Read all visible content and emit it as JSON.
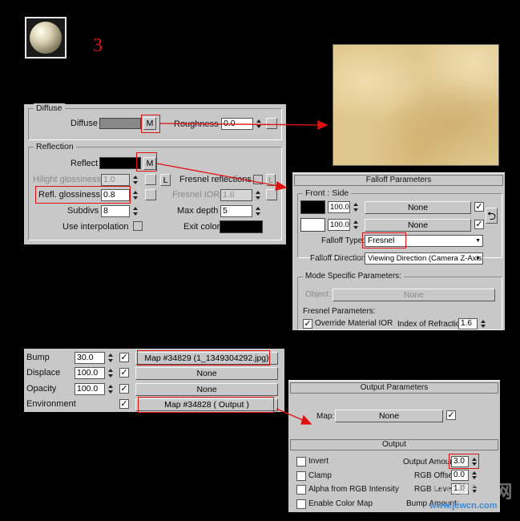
{
  "step_number": "3",
  "vray_panel": {
    "diffuse_group_title": "Diffuse",
    "diffuse_label": "Diffuse",
    "map_button": "M",
    "roughness_label": "Roughness",
    "roughness_value": "0.0",
    "reflection_group_title": "Reflection",
    "reflect_label": "Reflect",
    "hilight_glossiness_label": "Hilight glossiness",
    "hilight_glossiness_value": "1.0",
    "lock_button": "L",
    "fresnel_reflections_label": "Fresnel reflections",
    "refl_glossiness_label": "Refl. glossiness",
    "refl_glossiness_value": "0.8",
    "fresnel_ior_label": "Fresnel IOR",
    "fresnel_ior_value": "1.6",
    "subdivs_label": "Subdivs",
    "subdivs_value": "8",
    "max_depth_label": "Max depth",
    "max_depth_value": "5",
    "use_interpolation_label": "Use interpolation",
    "exit_color_label": "Exit color"
  },
  "falloff_panel": {
    "title": "Falloff Parameters",
    "front_side_label": "Front : Side",
    "row1_value": "100.0",
    "row1_map": "None",
    "row2_value": "100.0",
    "row2_map": "None",
    "falloff_type_label": "Falloff Type:",
    "falloff_type_value": "Fresnel",
    "falloff_direction_label": "Falloff Direction:",
    "falloff_direction_value": "Viewing Direction (Camera Z-Axis)",
    "mode_specific_label": "Mode Specific Parameters:",
    "object_label": "Object:",
    "object_value": "None",
    "fresnel_params_label": "Fresnel Parameters:",
    "override_ior_label": "Override Material IOR",
    "index_refraction_label": "Index of Refraction",
    "index_refraction_value": "1.6"
  },
  "maps_panel": {
    "rows": [
      {
        "label": "Bump",
        "value": "30.0",
        "map": "Map #34829 (1_1349304292.jpg)"
      },
      {
        "label": "Displace",
        "value": "100.0",
        "map": "None"
      },
      {
        "label": "Opacity",
        "value": "100.0",
        "map": "None"
      },
      {
        "label": "Environment",
        "value": "",
        "map": "Map #34828  ( Output )"
      }
    ]
  },
  "output_panel": {
    "params_title": "Output Parameters",
    "map_label": "Map:",
    "map_value": "None",
    "output_title": "Output",
    "invert_label": "Invert",
    "clamp_label": "Clamp",
    "alpha_label": "Alpha from RGB Intensity",
    "enable_color_map_label": "Enable Color Map",
    "output_amount_label": "Output Amount:",
    "output_amount_value": "3.0",
    "rgb_offset_label": "RGB Offset:",
    "rgb_offset_value": "0.0",
    "rgb_level_label": "RGB Level:",
    "rgb_level_value": "1.0",
    "bump_amount_label": "Bump Amount:"
  },
  "watermark": {
    "brand": "PS教程网",
    "url": "www.jcwcn.com"
  },
  "colors": {
    "background": "#000000",
    "panel": "#c8c8c8",
    "highlight_red": "#e01010",
    "diffuse_swatch": "#888888",
    "texture": "#e0c98e"
  }
}
